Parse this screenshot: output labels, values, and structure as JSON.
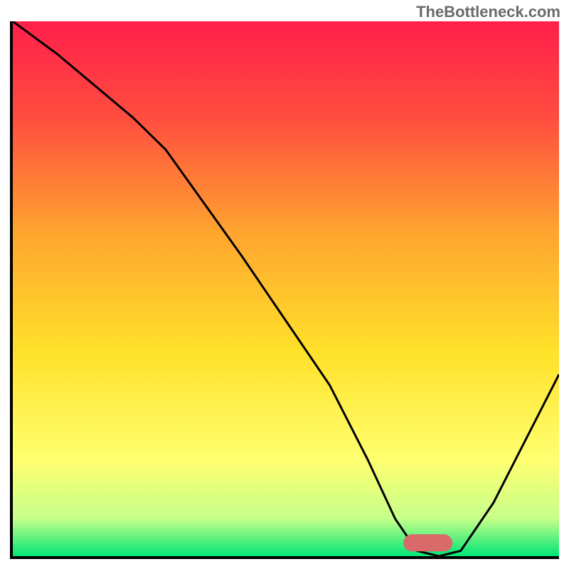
{
  "watermark": "TheBottleneck.com",
  "chart_data": {
    "type": "line",
    "title": "",
    "xlabel": "",
    "ylabel": "",
    "xlim": [
      0,
      100
    ],
    "ylim": [
      0,
      100
    ],
    "background_gradient": {
      "stops": [
        {
          "offset": 0.0,
          "color": "#ff1f4a"
        },
        {
          "offset": 0.18,
          "color": "#ff4d3f"
        },
        {
          "offset": 0.4,
          "color": "#ffa62e"
        },
        {
          "offset": 0.62,
          "color": "#ffe22a"
        },
        {
          "offset": 0.82,
          "color": "#ffff70"
        },
        {
          "offset": 0.93,
          "color": "#c6ff8a"
        },
        {
          "offset": 1.0,
          "color": "#00e676"
        }
      ]
    },
    "series": [
      {
        "name": "bottleneck-curve",
        "stroke": "#000000",
        "stroke_width": 3,
        "x": [
          0,
          8,
          15,
          22,
          28,
          35,
          42,
          50,
          58,
          65,
          70,
          74,
          78,
          82,
          88,
          94,
          100
        ],
        "y": [
          100,
          94,
          88,
          82,
          76,
          66,
          56,
          44,
          32,
          18,
          7,
          1,
          0,
          1,
          10,
          22,
          34
        ]
      }
    ],
    "marker": {
      "name": "optimum-marker",
      "x_center": 76,
      "y": 2.5,
      "width": 9,
      "height": 3.2,
      "fill": "#d86a6a",
      "rx": 1.6
    }
  }
}
